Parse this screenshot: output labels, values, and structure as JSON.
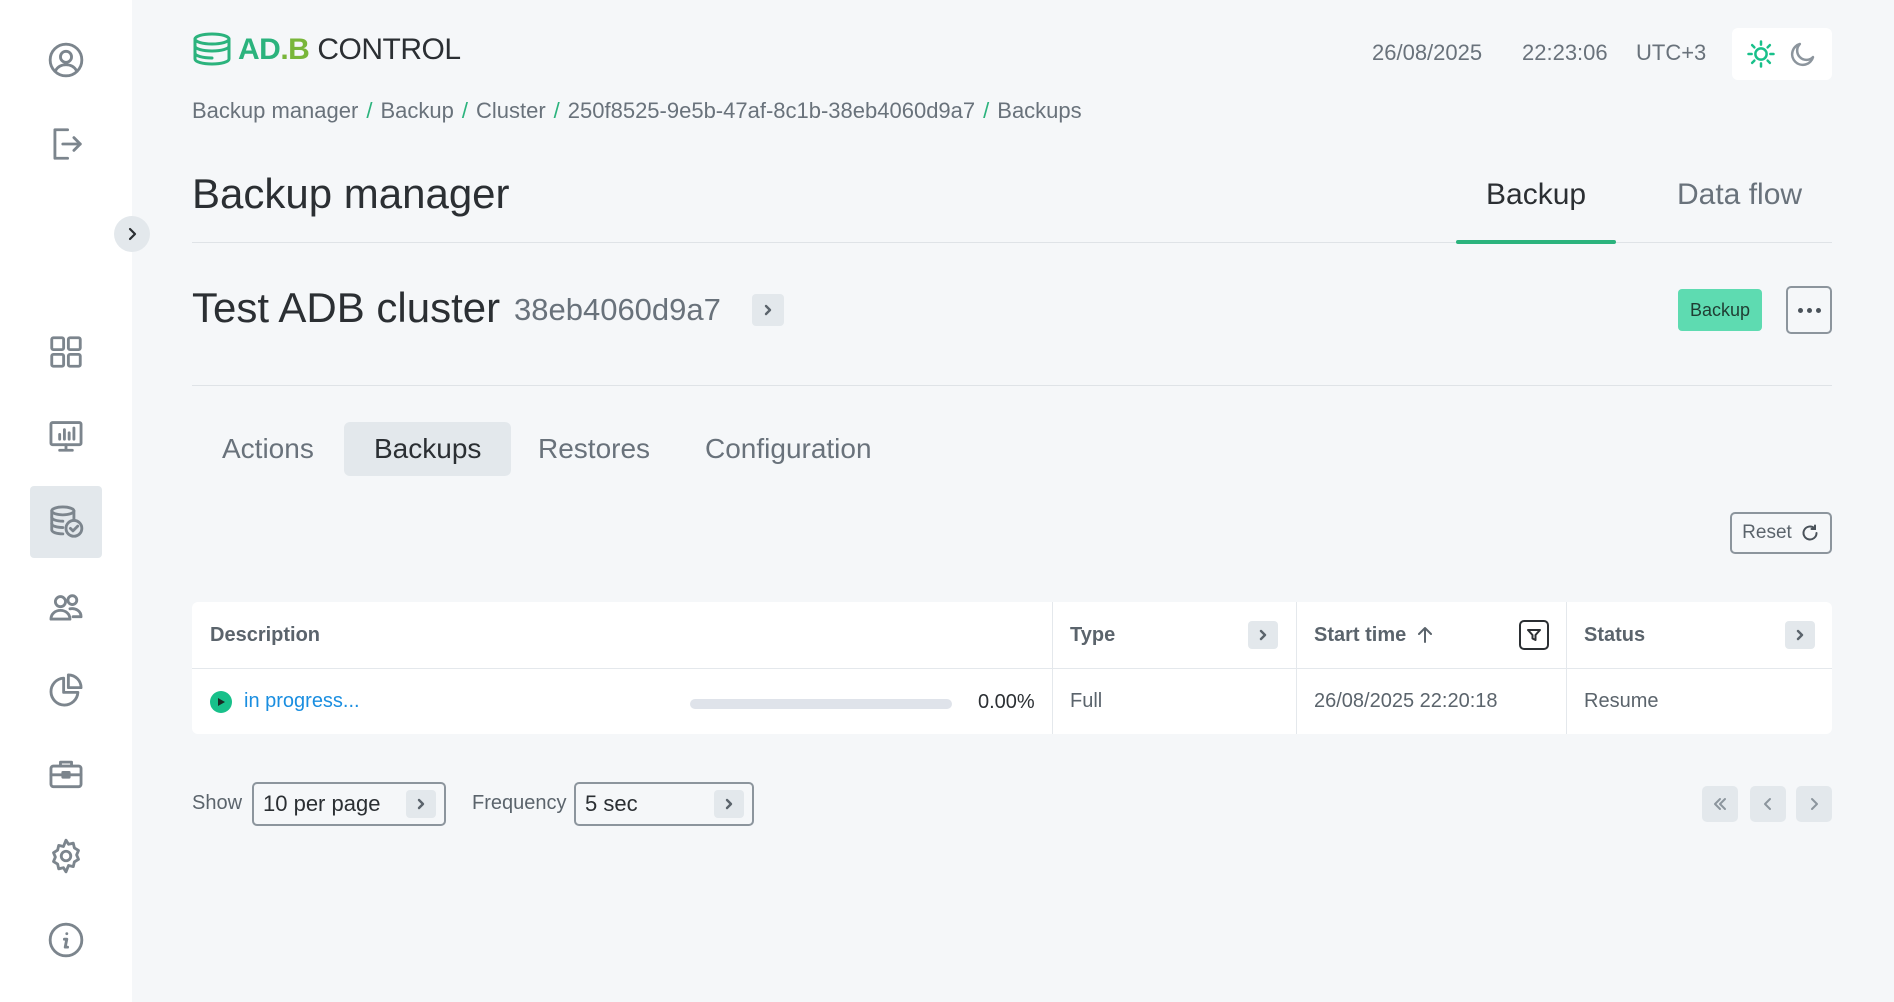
{
  "app": {
    "logo": {
      "part1": "AD",
      "part2": ".B",
      "part3": "CONTROL"
    },
    "date": "26/08/2025",
    "time": "22:23:06",
    "timezone": "UTC+3",
    "accent_color": "#2bb37d"
  },
  "sidebar": {
    "items": [
      {
        "icon": "user-icon"
      },
      {
        "icon": "logout-icon"
      },
      {
        "icon": "dashboard-icon"
      },
      {
        "icon": "monitoring-icon"
      },
      {
        "icon": "backup-database-icon",
        "active": true
      },
      {
        "icon": "users-icon"
      },
      {
        "icon": "pie-chart-icon"
      },
      {
        "icon": "briefcase-icon"
      },
      {
        "icon": "gear-icon"
      },
      {
        "icon": "info-icon"
      }
    ]
  },
  "breadcrumb": [
    "Backup manager",
    "Backup",
    "Cluster",
    "250f8525-9e5b-47af-8c1b-38eb4060d9a7",
    "Backups"
  ],
  "page": {
    "title": "Backup manager",
    "tabs": [
      {
        "label": "Backup",
        "active": true
      },
      {
        "label": "Data flow",
        "active": false
      }
    ]
  },
  "cluster": {
    "name": "Test ADB cluster",
    "id": "38eb4060d9a7",
    "badge": "Backup"
  },
  "sub_tabs": [
    {
      "label": "Actions",
      "active": false
    },
    {
      "label": "Backups",
      "active": true
    },
    {
      "label": "Restores",
      "active": false
    },
    {
      "label": "Configuration",
      "active": false
    }
  ],
  "reset_label": "Reset",
  "table": {
    "columns": [
      "Description",
      "Type",
      "Start time",
      "Status"
    ],
    "rows": [
      {
        "description": "in progress...",
        "progress": 0.0,
        "progress_text": "0.00%",
        "type": "Full",
        "start_time": "26/08/2025 22:20:18",
        "status": "Resume"
      }
    ]
  },
  "footer": {
    "show_label": "Show",
    "show_value": "10 per page",
    "frequency_label": "Frequency",
    "frequency_value": "5 sec"
  }
}
